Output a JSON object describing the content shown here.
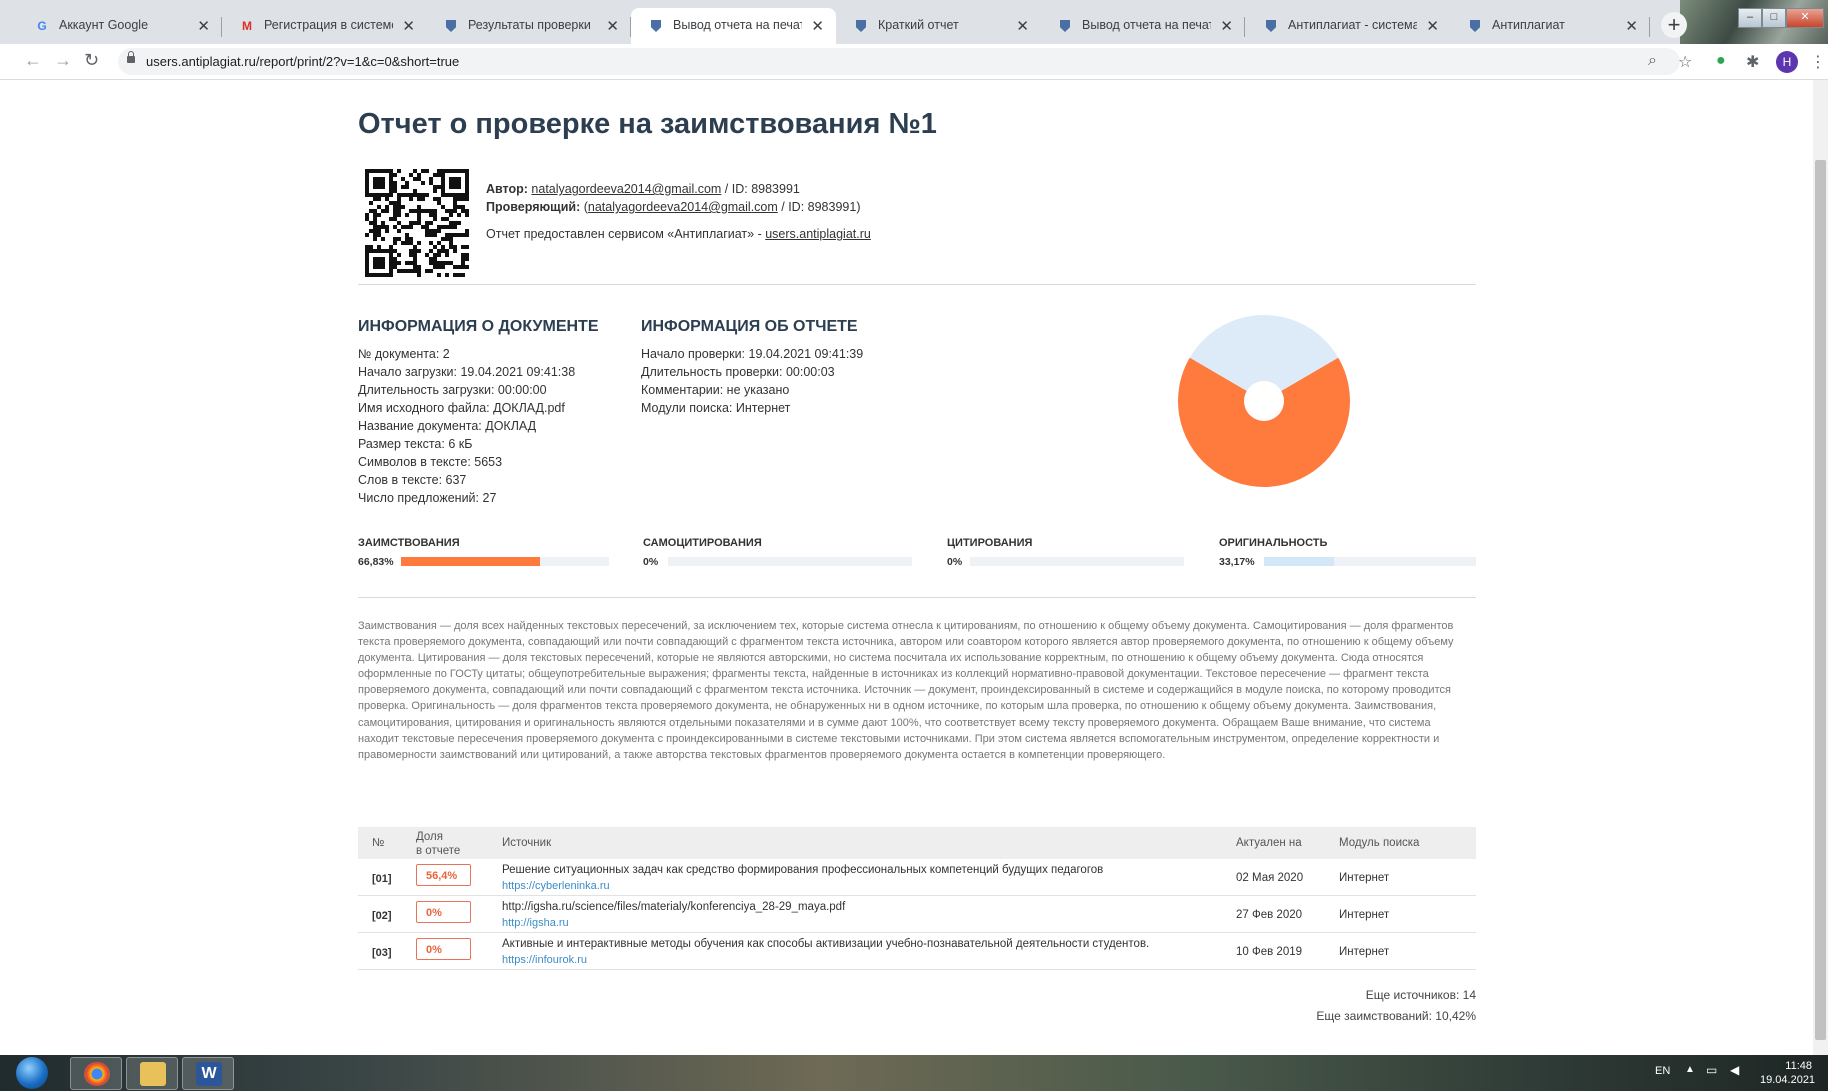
{
  "browser": {
    "tabs": [
      {
        "title": "Аккаунт Google",
        "icon": "google-icon"
      },
      {
        "title": "Регистрация в системе Ант",
        "icon": "gmail-icon"
      },
      {
        "title": "Результаты проверки",
        "icon": "shield-icon"
      },
      {
        "title": "Вывод отчета на печать - А",
        "icon": "shield-icon",
        "active": true
      },
      {
        "title": "Краткий отчет",
        "icon": "shield-icon"
      },
      {
        "title": "Вывод отчета на печать - А",
        "icon": "shield-icon"
      },
      {
        "title": "Антиплагиат - система для",
        "icon": "shield-icon"
      },
      {
        "title": "Антиплагиат",
        "icon": "shield-icon"
      }
    ],
    "url": "users.antiplagiat.ru/report/print/2?v=1&c=0&short=true",
    "profile_initial": "H"
  },
  "report": {
    "title": "Отчет о проверке на заимствования №1",
    "author_label": "Автор:",
    "author_email": "natalyagordeeva2014@gmail.com",
    "author_id": "/ ID: 8983991",
    "checker_label": "Проверяющий:",
    "checker_email": "natalyagordeeva2014@gmail.com",
    "checker_id": "/ ID: 8983991)",
    "service_note": "Отчет предоставлен сервисом «Антиплагиат» -",
    "service_link": "users.antiplagiat.ru"
  },
  "doc_info": {
    "heading": "ИНФОРМАЦИЯ О ДОКУМЕНТЕ",
    "lines": [
      "№ документа: 2",
      "Начало загрузки: 19.04.2021 09:41:38",
      "Длительность загрузки: 00:00:00",
      "Имя исходного файла: ДОКЛАД.pdf",
      "Название документа: ДОКЛАД",
      "Размер текста: 6 кБ",
      "Символов в тексте: 5653",
      "Слов в тексте: 637",
      "Число предложений: 27"
    ]
  },
  "report_info": {
    "heading": "ИНФОРМАЦИЯ ОБ ОТЧЕТЕ",
    "lines": [
      "Начало проверки: 19.04.2021 09:41:39",
      "Длительность проверки: 00:00:03",
      "Комментарии: не указано",
      "Модули поиска: Интернет"
    ]
  },
  "chart_data": {
    "type": "pie",
    "categories": [
      "Заимствования",
      "Оригинальность"
    ],
    "values": [
      66.83,
      33.17
    ],
    "colors": [
      "#ff7a3d",
      "#dcebf7"
    ]
  },
  "metrics": [
    {
      "label": "ЗАИМСТВОВАНИЯ",
      "value_text": "66,83%",
      "fraction": 0.6683,
      "color": "#ff7a3d"
    },
    {
      "label": "САМОЦИТИРОВАНИЯ",
      "value_text": "0%",
      "fraction": 0,
      "color": "#ff7a3d"
    },
    {
      "label": "ЦИТИРОВАНИЯ",
      "value_text": "0%",
      "fraction": 0,
      "color": "#ff7a3d"
    },
    {
      "label": "ОРИГИНАЛЬНОСТЬ",
      "value_text": "33,17%",
      "fraction": 0.3317,
      "color": "#d3e7f7"
    }
  ],
  "legend_text": "Заимствования — доля всех найденных текстовых пересечений, за исключением тех, которые система отнесла к цитированиям, по отношению к общему объему документа. Самоцитирования — доля фрагментов текста проверяемого документа, совпадающий или почти совпадающий с фрагментом текста источника, автором или соавтором которого является автор проверяемого документа, по отношению к общему объему документа. Цитирования — доля текстовых пересечений, которые не являются авторскими, но система посчитала их использование корректным, по отношению к общему объему документа. Сюда относятся оформленные по ГОСТу цитаты; общеупотребительные выражения; фрагменты текста, найденные в источниках из коллекций нормативно-правовой документации. Текстовое пересечение — фрагмент текста проверяемого документа, совпадающий или почти совпадающий с фрагментом текста источника. Источник — документ, проиндексированный в системе и содержащийся в модуле поиска, по которому проводится проверка. Оригинальность — доля фрагментов текста проверяемого документа, не обнаруженных ни в одном источнике, по которым шла проверка, по отношению к общему объему документа. Заимствования, самоцитирования, цитирования и оригинальность являются отдельными показателями и в сумме дают 100%, что соответствует всему тексту проверяемого документа. Обращаем Ваше внимание, что система находит текстовые пересечения проверяемого документа с проиндексированными в системе текстовыми источниками. При этом система является вспомогательным инструментом, определение корректности и правомерности заимствований или цитирований, а также авторства текстовых фрагментов проверяемого документа остается в компетенции проверяющего.",
  "sources_table": {
    "headers": {
      "num": "№",
      "share_1": "Доля",
      "share_2": "в отчете",
      "source": "Источник",
      "date": "Актуален на",
      "module": "Модуль поиска"
    },
    "rows": [
      {
        "num": "[01]",
        "share": "56,4%",
        "name": "Решение ситуационных задач как средство формирования профессиональных компетенций будущих педагогов",
        "link": "https://cyberleninka.ru",
        "date": "02 Мая 2020",
        "module": "Интернет"
      },
      {
        "num": "[02]",
        "share": "0%",
        "name": "http://igsha.ru/science/files/materialy/konferenciya_28-29_maya.pdf",
        "link": "http://igsha.ru",
        "date": "27 Фев 2020",
        "module": "Интернет"
      },
      {
        "num": "[03]",
        "share": "0%",
        "name": "Активные и интерактивные методы обучения как способы активизации учебно-познавательной деятельности студентов.",
        "link": "https://infourok.ru",
        "date": "10 Фев 2019",
        "module": "Интернет"
      }
    ]
  },
  "footer": {
    "more_sources": "Еще источников: 14",
    "more_borrowings": "Еще заимствований: 10,42%"
  },
  "taskbar": {
    "lang": "EN",
    "time": "11:48",
    "date": "19.04.2021"
  }
}
